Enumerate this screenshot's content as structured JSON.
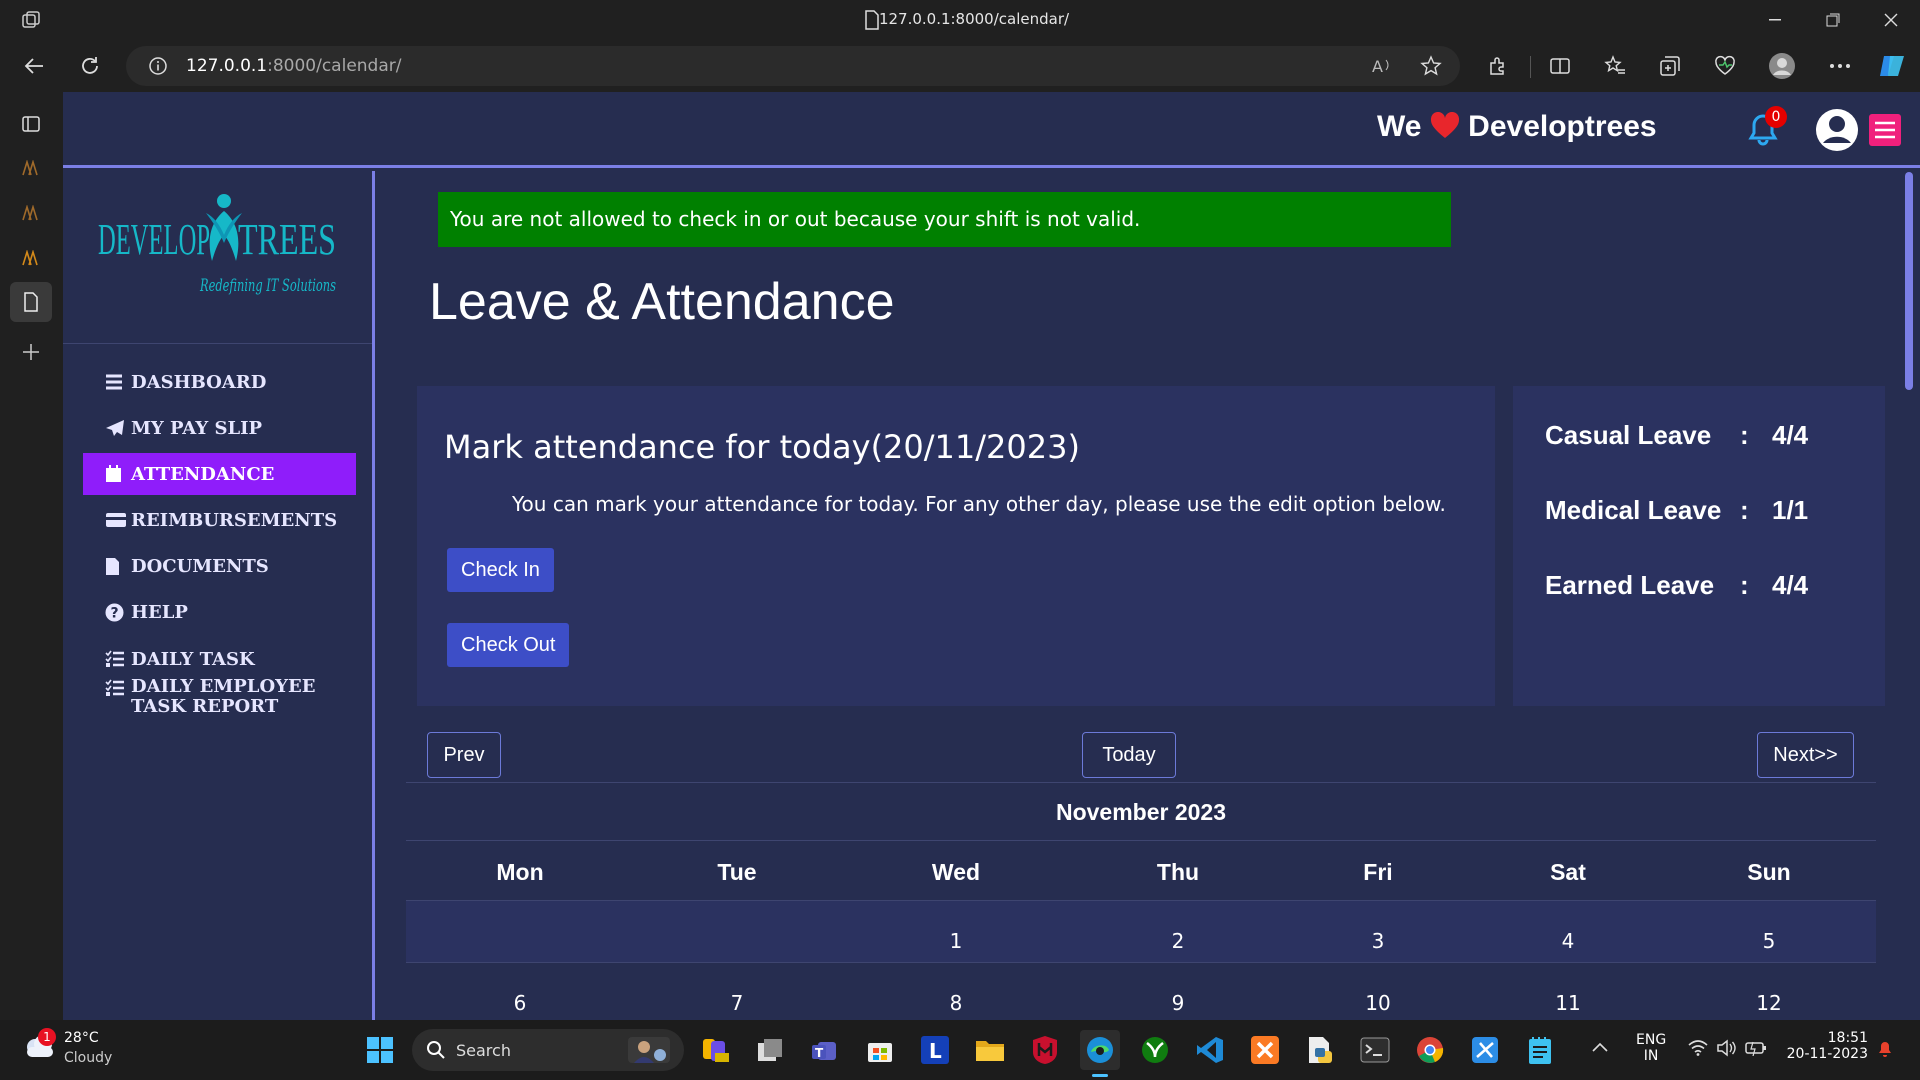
{
  "browser": {
    "tab_title": "127.0.0.1:8000/calendar/",
    "url_host": "127.0.0.1",
    "url_rest": ":8000/calendar/"
  },
  "site": {
    "brand_we": "We",
    "brand_name": "Developtrees",
    "notif_count": "0",
    "logo_word_left": "DEVELOP",
    "logo_word_right": "TREES",
    "logo_tagline": "Redefining IT Solutions"
  },
  "sidebar": {
    "items": [
      {
        "label": "DASHBOARD",
        "icon": "list-icon"
      },
      {
        "label": "MY PAY SLIP",
        "icon": "paper-plane-icon"
      },
      {
        "label": "ATTENDANCE",
        "icon": "calendar-icon"
      },
      {
        "label": "REIMBURSEMENTS",
        "icon": "credit-card-icon"
      },
      {
        "label": "DOCUMENTS",
        "icon": "file-icon"
      },
      {
        "label": "HELP",
        "icon": "question-circle-icon"
      },
      {
        "label": "DAILY TASK",
        "icon": "tasks-icon"
      },
      {
        "label": "DAILY EMPLOYEE",
        "label2": "TASK REPORT",
        "icon": "tasks-icon"
      }
    ]
  },
  "main": {
    "alert": "You are not allowed to check in or out because your shift is not valid.",
    "title": "Leave & Attendance",
    "attendance": {
      "title": "Mark attendance for today(20/11/2023)",
      "note": "You can mark your attendance for today. For any other day, please use the edit option below.",
      "check_in": "Check In",
      "check_out": "Check Out"
    },
    "leaves": [
      {
        "name": "Casual Leave",
        "colon": ":",
        "value": "4/4"
      },
      {
        "name": "Medical Leave",
        "colon": ":",
        "value": "1/1"
      },
      {
        "name": "Earned Leave",
        "colon": ":",
        "value": "4/4"
      }
    ],
    "calendar": {
      "prev": "Prev",
      "today": "Today",
      "next": "Next>>",
      "month": "November 2023",
      "days": [
        "Mon",
        "Tue",
        "Wed",
        "Thu",
        "Fri",
        "Sat",
        "Sun"
      ],
      "week1": [
        "",
        "",
        "1",
        "2",
        "3",
        "4",
        "5"
      ],
      "week2": [
        "6",
        "7",
        "8",
        "9",
        "10",
        "11",
        "12"
      ]
    }
  },
  "taskbar": {
    "weather_temp": "28°C",
    "weather_desc": "Cloudy",
    "weather_badge": "1",
    "search": "Search",
    "lang1": "ENG",
    "lang2": "IN",
    "time": "18:51",
    "date": "20-11-2023"
  },
  "colors": {
    "accent": "#8f1dfa",
    "alert_bg": "#008000",
    "button": "#3d4ec7",
    "page_bg": "#262d50",
    "card_bg": "#2b3260"
  }
}
